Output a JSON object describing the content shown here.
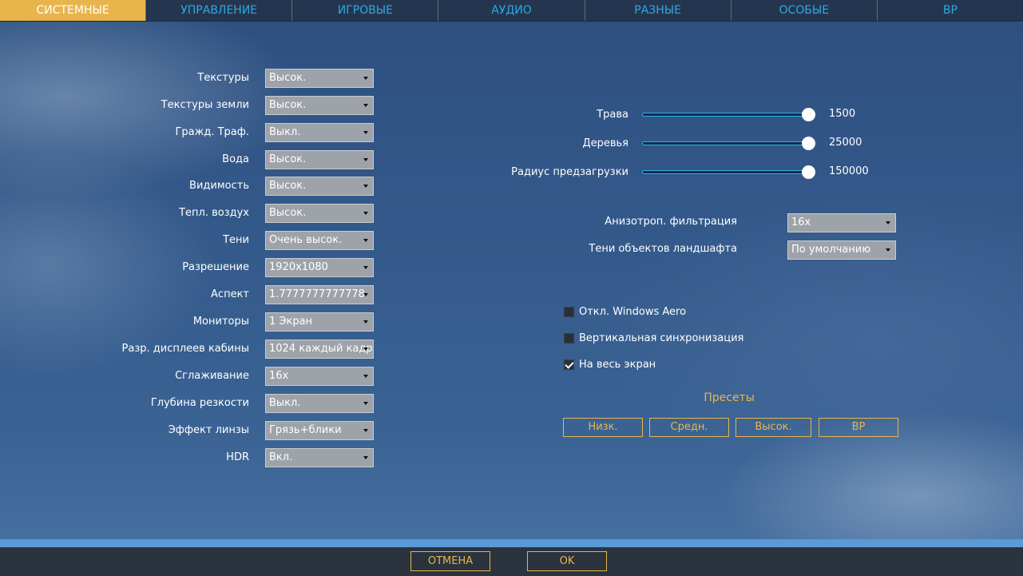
{
  "tabs": [
    {
      "label": "СИСТЕМНЫЕ",
      "active": true
    },
    {
      "label": "УПРАВЛЕНИЕ"
    },
    {
      "label": "ИГРОВЫЕ"
    },
    {
      "label": "АУДИО"
    },
    {
      "label": "РАЗНЫЕ"
    },
    {
      "label": "ОСОБЫЕ"
    },
    {
      "label": "ВР"
    }
  ],
  "settings": [
    {
      "label": "Текстуры",
      "value": "Высок."
    },
    {
      "label": "Текстуры земли",
      "value": "Высок."
    },
    {
      "label": "Гражд. Траф.",
      "value": "Выкл."
    },
    {
      "label": "Вода",
      "value": "Высок."
    },
    {
      "label": "Видимость",
      "value": "Высок."
    },
    {
      "label": "Тепл. воздух",
      "value": "Высок."
    },
    {
      "label": "Тени",
      "value": "Очень высок."
    },
    {
      "label": "Разрешение",
      "value": "1920x1080"
    },
    {
      "label": "Аспект",
      "value": "1.7777777777778"
    },
    {
      "label": "Мониторы",
      "value": "1 Экран"
    },
    {
      "label": "Разр. дисплеев кабины",
      "value": "1024 каждый кадр"
    },
    {
      "label": "Сглаживание",
      "value": "16x"
    },
    {
      "label": "Глубина резкости",
      "value": "Выкл."
    },
    {
      "label": "Эффект линзы",
      "value": "Грязь+блики"
    },
    {
      "label": "HDR",
      "value": "Вкл."
    }
  ],
  "sliders": [
    {
      "label": "Трава",
      "value": "1500",
      "fill": 1.0
    },
    {
      "label": "Деревья",
      "value": "25000",
      "fill": 1.0
    },
    {
      "label": "Радиус предзагрузки",
      "value": "150000",
      "fill": 1.0
    }
  ],
  "right_selects": [
    {
      "label": "Анизотроп. фильтрация",
      "value": "16x"
    },
    {
      "label": "Тени объектов ландшафта",
      "value": "По умолчанию"
    }
  ],
  "checkboxes": [
    {
      "label": "Откл. Windows Aero",
      "checked": false
    },
    {
      "label": "Вертикальная синхронизация",
      "checked": false
    },
    {
      "label": "На весь экран",
      "checked": true
    }
  ],
  "presets": {
    "title": "Пресеты",
    "buttons": [
      "Низк.",
      "Средн.",
      "Высок.",
      "ВР"
    ]
  },
  "footer": {
    "cancel": "ОТМЕНА",
    "ok": "OK"
  },
  "colors": {
    "accent": "#e8b54c",
    "tab_text": "#2fa8e6",
    "slider": "#2fb0f0"
  }
}
